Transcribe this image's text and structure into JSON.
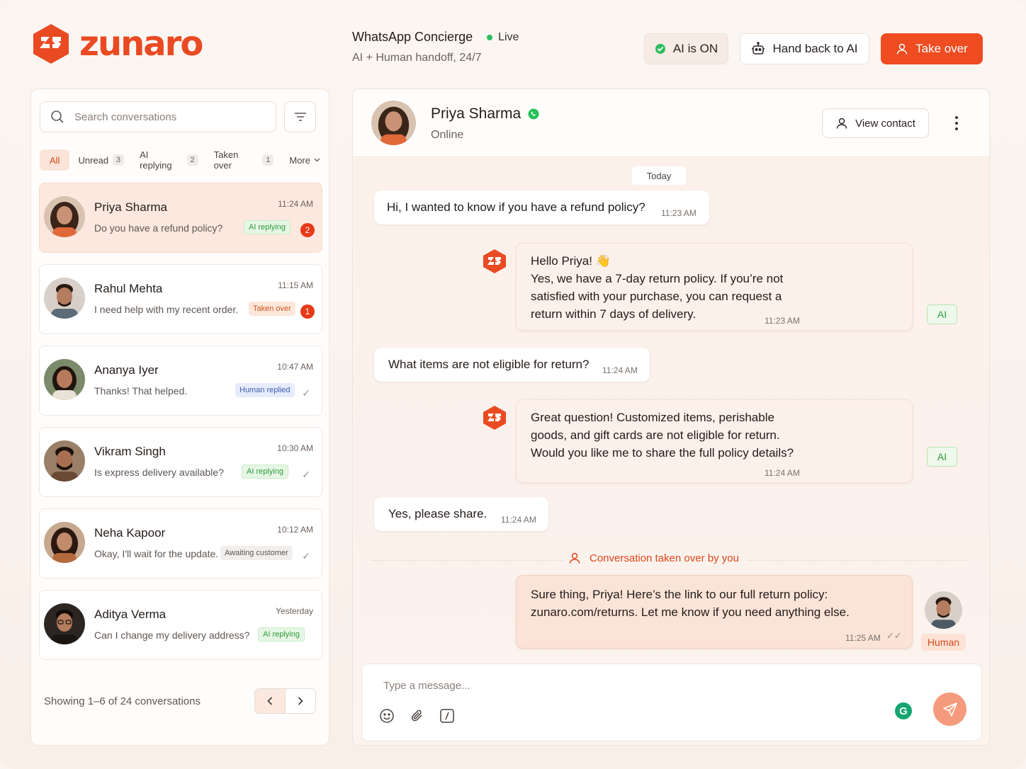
{
  "brand": {
    "name": "zunaro"
  },
  "header": {
    "title": "WhatsApp Concierge",
    "live_label": "Live",
    "subtitle": "AI + Human handoff, 24/7",
    "ai_on_label": "AI is ON",
    "hand_back_label": "Hand back to AI",
    "take_over_label": "Take over"
  },
  "colors": {
    "accent": "#ef4c22",
    "live": "#2ebd5e",
    "ai_green": "#2d9c3e"
  },
  "sidebar": {
    "search_placeholder": "Search conversations",
    "tabs": [
      {
        "label": "All",
        "count": ""
      },
      {
        "label": "Unread",
        "count": "3"
      },
      {
        "label": "AI replying",
        "count": "2"
      },
      {
        "label": "Taken over",
        "count": "1"
      },
      {
        "label": "More",
        "count": ""
      }
    ],
    "conversations": [
      {
        "name": "Priya Sharma",
        "time": "11:24 AM",
        "message": "Do you have a refund policy?",
        "status": "AI replying",
        "unread": "2"
      },
      {
        "name": "Rahul Mehta",
        "time": "11:15 AM",
        "message": "I need help with my recent order.",
        "status": "Taken over",
        "unread": "1"
      },
      {
        "name": "Ananya Iyer",
        "time": "10:47 AM",
        "message": "Thanks! That helped.",
        "status": "Human replied",
        "unread": ""
      },
      {
        "name": "Vikram Singh",
        "time": "10:30 AM",
        "message": "Is express delivery available?",
        "status": "AI replying",
        "unread": ""
      },
      {
        "name": "Neha Kapoor",
        "time": "10:12 AM",
        "message": "Okay, I'll wait for the update.",
        "status": "Awaiting customer",
        "unread": ""
      },
      {
        "name": "Aditya Verma",
        "time": "Yesterday",
        "message": "Can I change my delivery address?",
        "status": "AI replying",
        "unread": ""
      }
    ],
    "showing": "Showing 1–6 of 24 conversations"
  },
  "chat": {
    "contact_name": "Priya Sharma",
    "contact_status": "Online",
    "view_contact_label": "View contact",
    "date_divider": "Today",
    "messages": [
      {
        "from": "customer",
        "text": "Hi, I wanted to know if you have a refund policy?",
        "time": "11:23 AM"
      },
      {
        "from": "ai",
        "lines": [
          "Hello Priya! 👋",
          "Yes, we have a 7-day return policy. If you’re not",
          "satisfied with your purchase, you can request a",
          "return within 7 days of delivery."
        ],
        "time": "11:23 AM",
        "tag": "AI"
      },
      {
        "from": "customer",
        "text": "What items are not eligible for return?",
        "time": "11:24 AM"
      },
      {
        "from": "ai",
        "lines": [
          "Great question! Customized items, perishable",
          "goods, and gift cards are not eligible for return.",
          "Would you like me to share the full policy details?"
        ],
        "time": "11:24 AM",
        "tag": "AI"
      },
      {
        "from": "customer",
        "text": "Yes, please share.",
        "time": "11:24 AM"
      },
      {
        "from": "human",
        "lines": [
          "Sure thing, Priya! Here’s the link to our full return policy:",
          "zunaro.com/returns. Let me know if you need anything else."
        ],
        "time": "11:25 AM",
        "tag": "Human"
      }
    ],
    "takeover_notice": "Conversation taken over by you",
    "composer_placeholder": "Type a message..."
  }
}
